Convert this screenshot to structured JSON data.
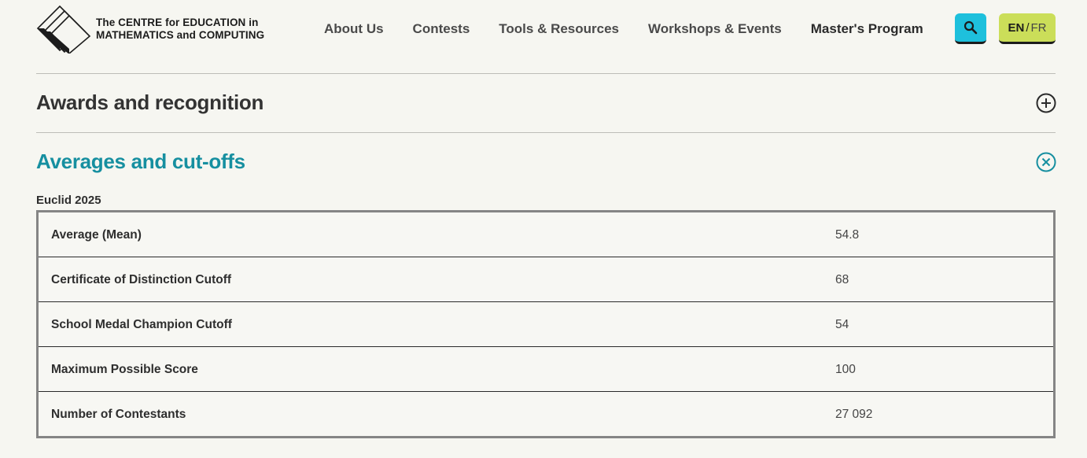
{
  "logo": {
    "line1": "The CENTRE for EDUCATION in",
    "line2": "MATHEMATICS and COMPUTING"
  },
  "nav": {
    "items": [
      {
        "label": "About Us"
      },
      {
        "label": "Contests"
      },
      {
        "label": "Tools & Resources"
      },
      {
        "label": "Workshops & Events"
      },
      {
        "label": "Master's Program"
      }
    ]
  },
  "header": {
    "search_icon": "search-icon",
    "lang_en": "EN",
    "lang_sep": "/",
    "lang_fr": "FR"
  },
  "sections": {
    "awards": {
      "title": "Awards and recognition",
      "icon": "plus-circle-icon"
    },
    "averages": {
      "title": "Averages and cut-offs",
      "icon": "close-circle-icon"
    }
  },
  "table": {
    "caption": "Euclid 2025",
    "rows": [
      {
        "label": "Average (Mean)",
        "value": "54.8"
      },
      {
        "label": "Certificate of Distinction Cutoff",
        "value": "68"
      },
      {
        "label": "School Medal Champion Cutoff",
        "value": "54"
      },
      {
        "label": "Maximum Possible Score",
        "value": "100"
      },
      {
        "label": "Number of Contestants",
        "value": "27 092"
      }
    ]
  },
  "colors": {
    "background": "#f6f6f1",
    "accent_teal": "#168fa0",
    "search_button": "#1ec0dc",
    "lang_button": "#cbde59"
  }
}
